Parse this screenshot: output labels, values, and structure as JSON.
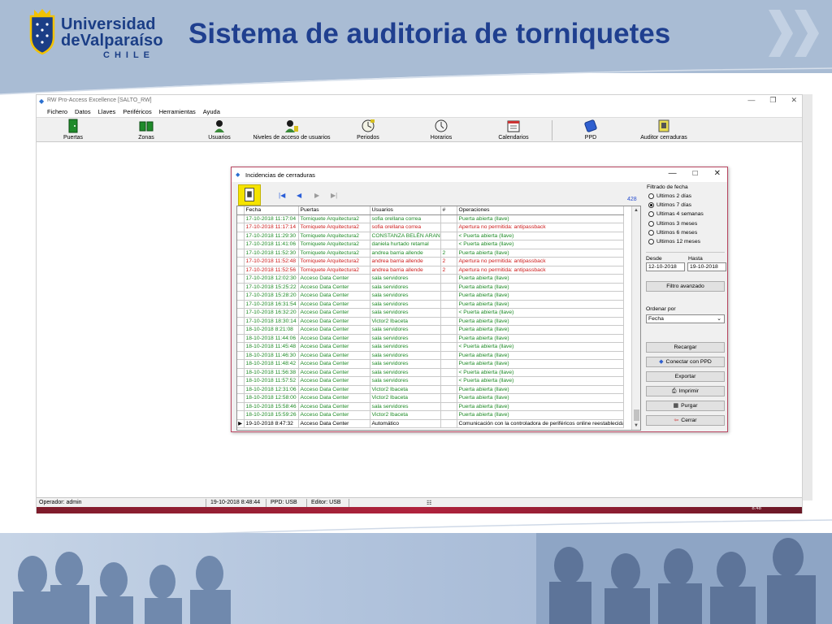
{
  "slide": {
    "logo_line1": "Universidad",
    "logo_line2": "deValparaíso",
    "logo_line3": "CHILE",
    "title": "Sistema de auditoria de torniquetes"
  },
  "app": {
    "window_title": "RW Pro-Access Excellence [SALTO_RW]",
    "menu": [
      "Fichero",
      "Datos",
      "Llaves",
      "Periféricos",
      "Herramientas",
      "Ayuda"
    ],
    "toolbar": [
      {
        "label": "Puertas",
        "icon": "door-icon"
      },
      {
        "label": "Zonas",
        "icon": "zones-icon"
      },
      {
        "label": "Usuarios",
        "icon": "user-icon"
      },
      {
        "label": "Niveles de acceso de usuarios",
        "icon": "user-access-icon"
      },
      {
        "label": "Periodos",
        "icon": "period-clock-icon"
      },
      {
        "label": "Horarios",
        "icon": "schedule-clock-icon"
      },
      {
        "label": "Calendarios",
        "icon": "calendar-icon"
      },
      {
        "label": "PPD",
        "icon": "ppd-device-icon"
      },
      {
        "label": "Auditor cerraduras",
        "icon": "lock-audit-icon"
      }
    ],
    "status": {
      "operator": "Operador: admin",
      "datetime": "19-10-2018 8:48:44",
      "ppd": "PPD: USB",
      "editor": "Editor: USB"
    },
    "taskbar_time": "8:48"
  },
  "dialog": {
    "title": "Incidencias de cerraduras",
    "count": "428",
    "columns": [
      "Fecha",
      "Puertas",
      "Usuarios",
      "#",
      "Operaciones"
    ],
    "rows": [
      {
        "c": "g",
        "v": [
          "17-10-2018 11:17:04",
          "Torniquete Arquitectura2",
          "sofia orellana correa",
          "",
          "Puerta abierta (llave)"
        ]
      },
      {
        "c": "r",
        "v": [
          "17-10-2018 11:17:14",
          "Torniquete Arquitectura2",
          "sofia orellana correa",
          "",
          "Apertura no permitida: antipassback"
        ]
      },
      {
        "c": "g",
        "v": [
          "17-10-2018 11:29:30",
          "Torniquete Arquitectura2",
          "CONSTANZA BELÉN ARANDA",
          "",
          "< Puerta abierta (llave)"
        ]
      },
      {
        "c": "g",
        "v": [
          "17-10-2018 11:41:06",
          "Torniquete Arquitectura2",
          "daniela hurtado retamal",
          "",
          "< Puerta abierta (llave)"
        ]
      },
      {
        "c": "g",
        "v": [
          "17-10-2018 11:52:30",
          "Torniquete Arquitectura2",
          "andrea barria allende",
          "2",
          "Puerta abierta (llave)"
        ]
      },
      {
        "c": "r",
        "v": [
          "17-10-2018 11:52:48",
          "Torniquete Arquitectura2",
          "andrea barria allende",
          "2",
          "Apertura no permitida: antipassback"
        ]
      },
      {
        "c": "r",
        "v": [
          "17-10-2018 11:52:56",
          "Torniquete Arquitectura2",
          "andrea barria allende",
          "2",
          "Apertura no permitida: antipassback"
        ]
      },
      {
        "c": "g",
        "v": [
          "17-10-2018 12:02:30",
          "Acceso Data Center",
          "sala servidores",
          "",
          "Puerta abierta (llave)"
        ]
      },
      {
        "c": "g",
        "v": [
          "17-10-2018 15:25:22",
          "Acceso Data Center",
          "sala servidores",
          "",
          "Puerta abierta (llave)"
        ]
      },
      {
        "c": "g",
        "v": [
          "17-10-2018 15:28:20",
          "Acceso Data Center",
          "sala servidores",
          "",
          "Puerta abierta (llave)"
        ]
      },
      {
        "c": "g",
        "v": [
          "17-10-2018 16:31:54",
          "Acceso Data Center",
          "sala servidores",
          "",
          "Puerta abierta (llave)"
        ]
      },
      {
        "c": "g",
        "v": [
          "17-10-2018 16:32:20",
          "Acceso Data Center",
          "sala servidores",
          "",
          "< Puerta abierta (llave)"
        ]
      },
      {
        "c": "g",
        "v": [
          "17-10-2018 18:30:14",
          "Acceso Data Center",
          "Victor2 Ibaceta",
          "",
          "Puerta abierta (llave)"
        ]
      },
      {
        "c": "g",
        "v": [
          "18-10-2018 8:21:08",
          "Acceso Data Center",
          "sala servidores",
          "",
          "Puerta abierta (llave)"
        ]
      },
      {
        "c": "g",
        "v": [
          "18-10-2018 11:44:06",
          "Acceso Data Center",
          "sala servidores",
          "",
          "Puerta abierta (llave)"
        ]
      },
      {
        "c": "g",
        "v": [
          "18-10-2018 11:45:48",
          "Acceso Data Center",
          "sala servidores",
          "",
          "< Puerta abierta (llave)"
        ]
      },
      {
        "c": "g",
        "v": [
          "18-10-2018 11:46:30",
          "Acceso Data Center",
          "sala servidores",
          "",
          "Puerta abierta (llave)"
        ]
      },
      {
        "c": "g",
        "v": [
          "18-10-2018 11:48:42",
          "Acceso Data Center",
          "sala servidores",
          "",
          "Puerta abierta (llave)"
        ]
      },
      {
        "c": "g",
        "v": [
          "18-10-2018 11:56:38",
          "Acceso Data Center",
          "sala servidores",
          "",
          "< Puerta abierta (llave)"
        ]
      },
      {
        "c": "g",
        "v": [
          "18-10-2018 11:57:52",
          "Acceso Data Center",
          "sala servidores",
          "",
          "< Puerta abierta (llave)"
        ]
      },
      {
        "c": "g",
        "v": [
          "18-10-2018 12:31:06",
          "Acceso Data Center",
          "Victor2 Ibaceta",
          "",
          "Puerta abierta (llave)"
        ]
      },
      {
        "c": "g",
        "v": [
          "18-10-2018 12:58:00",
          "Acceso Data Center",
          "Victor2 Ibaceta",
          "",
          "Puerta abierta (llave)"
        ]
      },
      {
        "c": "g",
        "v": [
          "18-10-2018 15:58:46",
          "Acceso Data Center",
          "sala servidores",
          "",
          "Puerta abierta (llave)"
        ]
      },
      {
        "c": "g",
        "v": [
          "18-10-2018 15:59:26",
          "Acceso Data Center",
          "Victor2 Ibaceta",
          "",
          "Puerta abierta (llave)"
        ]
      },
      {
        "c": "b",
        "v": [
          "19-10-2018 8:47:32",
          "Acceso Data Center",
          "Automático",
          "",
          "Comunicación con la controladora de periféricos online reestablecida"
        ]
      }
    ],
    "side": {
      "filter_label": "Filtrado de fecha",
      "options": [
        {
          "label": "Ultimos 2 días",
          "selected": false
        },
        {
          "label": "Ultimos 7 días",
          "selected": true
        },
        {
          "label": "Ultimas 4 semanas",
          "selected": false
        },
        {
          "label": "Ultimos 3 meses",
          "selected": false
        },
        {
          "label": "Ultimos 6 meses",
          "selected": false
        },
        {
          "label": "Ultimos 12 meses",
          "selected": false
        }
      ],
      "from_label": "Desde",
      "to_label": "Hasta",
      "from_value": "12-10-2018",
      "to_value": "19-10-2018",
      "advanced_filter": "Filtro avanzado",
      "order_label": "Ordenar por",
      "order_value": "Fecha",
      "buttons": [
        {
          "label": "Recargar",
          "icon": ""
        },
        {
          "label": "Conectar con PPD",
          "icon": "ppd-icon"
        },
        {
          "label": "Exportar",
          "icon": ""
        },
        {
          "label": "Imprimir",
          "icon": "printer-icon"
        },
        {
          "label": "Purgar",
          "icon": "purge-icon"
        },
        {
          "label": "Cerrar",
          "icon": "exit-icon"
        }
      ]
    }
  },
  "colors": {
    "header_band": "#a9bcd4",
    "title_blue": "#1f3f8f",
    "ok_green": "#1d8a25",
    "error_red": "#cc1b1b",
    "lock_yellow": "#f5e300"
  }
}
